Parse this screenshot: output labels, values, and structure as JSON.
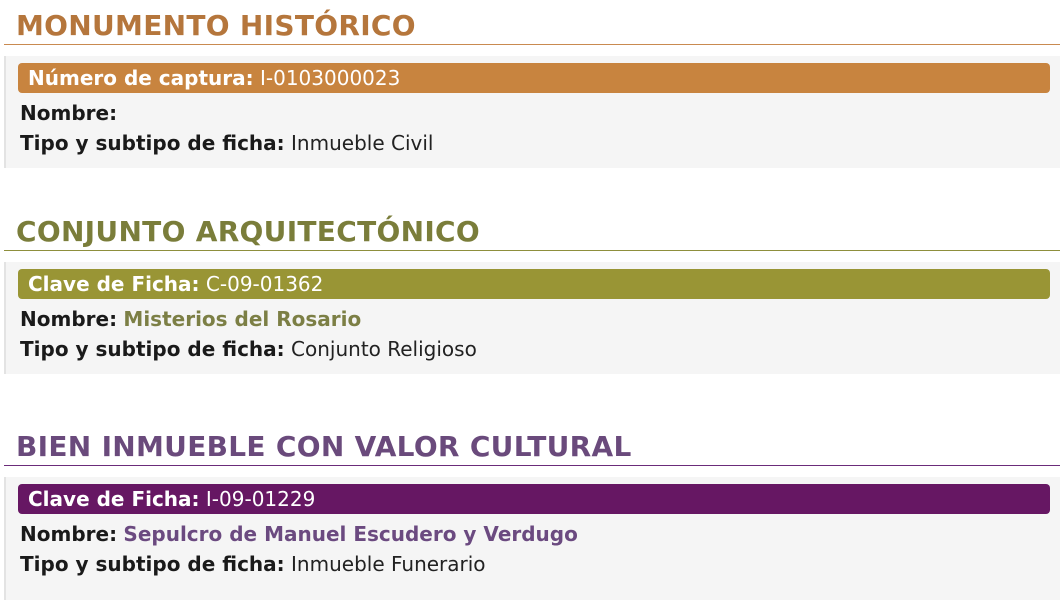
{
  "sections": [
    {
      "title": "MONUMENTO HISTÓRICO",
      "id_label": "Número de captura:",
      "id_value": "I-0103000023",
      "name_label": "Nombre:",
      "name_value": "",
      "type_label": "Tipo y subtipo de ficha:",
      "type_value": "Inmueble Civil"
    },
    {
      "title": "CONJUNTO ARQUITECTÓNICO",
      "id_label": "Clave de Ficha:",
      "id_value": "C-09-01362",
      "name_label": "Nombre:",
      "name_value": "Misterios del Rosario",
      "type_label": "Tipo y subtipo de ficha:",
      "type_value": "Conjunto Religioso"
    },
    {
      "title": "BIEN INMUEBLE CON VALOR CULTURAL",
      "id_label": "Clave de Ficha:",
      "id_value": "I-09-01229",
      "name_label": "Nombre:",
      "name_value": "Sepulcro de Manuel Escudero y Verdugo",
      "type_label": "Tipo y subtipo de ficha:",
      "type_value": "Inmueble Funerario"
    }
  ],
  "colors": {
    "monumento": "#c8843f",
    "conjunto": "#999535",
    "bien_inmueble": "#661763"
  }
}
